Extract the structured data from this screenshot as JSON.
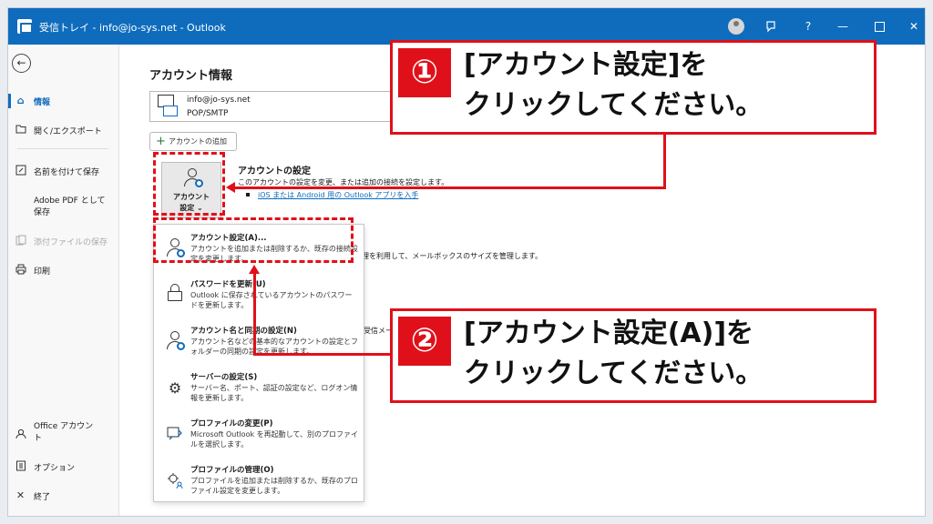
{
  "window": {
    "title": "受信トレイ - info@jo-sys.net - Outlook",
    "help_label": "?",
    "minimize_label": "—",
    "close_label": "✕"
  },
  "sidebar": {
    "back_icon": "←",
    "items": [
      {
        "label": "情報",
        "icon": "home-icon"
      },
      {
        "label": "開く/エクスポート",
        "icon": "folder-icon"
      },
      {
        "label": "名前を付けて保存",
        "icon": "save-as-icon"
      },
      {
        "label_line1": "Adobe PDF として",
        "label_line2": "保存"
      },
      {
        "label": "添付ファイルの保存",
        "icon": "attachment-icon"
      },
      {
        "label": "印刷",
        "icon": "print-icon"
      },
      {
        "label_line1": "Office アカウン",
        "label_line2": "ト",
        "icon": "person-icon"
      },
      {
        "label": "オプション",
        "icon": "options-icon"
      },
      {
        "label": "終了",
        "icon": "close-icon"
      }
    ]
  },
  "main": {
    "page_title": "アカウント情報",
    "account": {
      "email": "info@jo-sys.net",
      "type": "POP/SMTP"
    },
    "add_account_label": "アカウントの追加",
    "account_settings_button": {
      "line1": "アカウント",
      "line2": "設定 ⌄"
    },
    "account_settings_section": {
      "title": "アカウントの設定",
      "description": "このアカウントの設定を変更、または追加の接続を設定します。",
      "link": "iOS または Android 用の Outlook アプリを入手"
    },
    "partial_text_1": "理を利用して、メールボックスのサイズを管理します。",
    "partial_text_2": "受信メール"
  },
  "dropdown": {
    "items": [
      {
        "title": "アカウント設定(A)...",
        "desc": "アカウントを追加または削除するか、既存の接続設定を変更します。"
      },
      {
        "title": "パスワードを更新(U)",
        "desc": "Outlook に保存されているアカウントのパスワードを更新します。"
      },
      {
        "title": "アカウント名と同期の設定(N)",
        "desc": "アカウント名などの基本的なアカウントの設定とフォルダーの同期の設定を更新します。"
      },
      {
        "title": "サーバーの設定(S)",
        "desc": "サーバー名、ポート、認証の設定など、ログオン情報を更新します。"
      },
      {
        "title": "プロファイルの変更(P)",
        "desc": "Microsoft Outlook を再起動して、別のプロファイルを選択します。"
      },
      {
        "title": "プロファイルの管理(O)",
        "desc": "プロファイルを追加または削除するか、既存のプロファイル設定を変更します。"
      }
    ]
  },
  "callouts": [
    {
      "number": "①",
      "line1": "[アカウント設定]を",
      "line2": "クリックしてください。"
    },
    {
      "number": "②",
      "line1": "[アカウント設定(A)]を",
      "line2": "クリックしてください。"
    }
  ],
  "colors": {
    "accent": "#0f6cbd",
    "highlight": "#e0101a"
  }
}
